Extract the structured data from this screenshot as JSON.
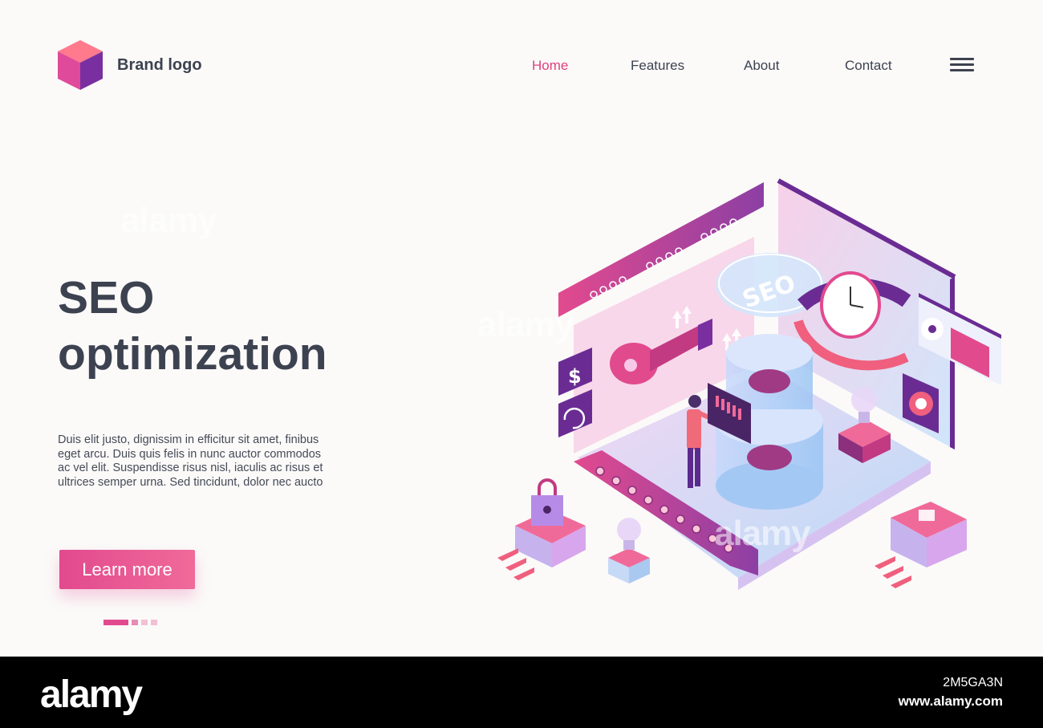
{
  "brand": {
    "name": "Brand logo"
  },
  "nav": {
    "items": [
      {
        "label": "Home",
        "active": true
      },
      {
        "label": "Features",
        "active": false
      },
      {
        "label": "About",
        "active": false
      },
      {
        "label": "Contact",
        "active": false
      }
    ],
    "menu_icon": "hamburger-menu-icon"
  },
  "hero": {
    "title_line1": "SEO",
    "title_line2": "optimization",
    "description": "Duis elit justo, dignissim in efficitur sit amet, finibus eget arcu. Duis quis felis in nunc auctor commodos ac vel elit. Suspendisse risus nisl, iaculis ac risus et ultrices semper urna. Sed tincidunt, dolor nec aucto",
    "cta_label": "Learn more"
  },
  "illustration": {
    "seo_label": "SEO",
    "icons": [
      "dollar-icon",
      "refresh-icon",
      "key-icon",
      "clock-icon",
      "lock-icon",
      "lightbulb-icon",
      "bar-chart-icon",
      "target-icon"
    ]
  },
  "pagination": {
    "count": 4,
    "active_index": 0
  },
  "watermark": {
    "text": "alamy"
  },
  "footer": {
    "brand": "alamy",
    "image_id": "2M5GA3N",
    "url": "www.alamy.com"
  },
  "colors": {
    "accent": "#e0407d",
    "primary_pink": "#e24a8e",
    "purple": "#5b2a8c",
    "text_dark": "#3d4250"
  }
}
